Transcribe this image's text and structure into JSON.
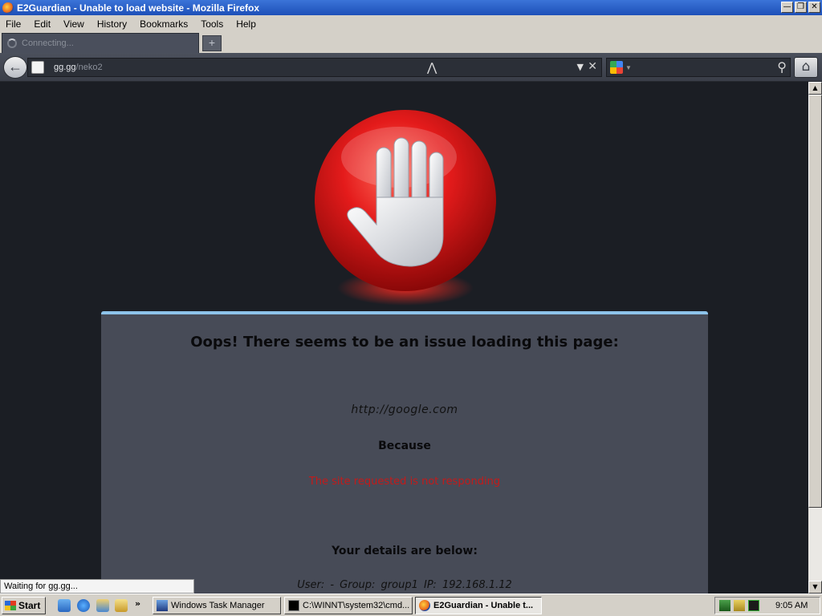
{
  "window": {
    "title": "E2Guardian - Unable to load website - Mozilla Firefox",
    "minimize": "0",
    "maximize": "2",
    "close": "r"
  },
  "menu": [
    "File",
    "Edit",
    "View",
    "History",
    "Bookmarks",
    "Tools",
    "Help"
  ],
  "tabs": [
    {
      "label": "Connecting...",
      "state": "loading"
    }
  ],
  "newtab_label": "+",
  "nav": {
    "url_host": "gg.gg",
    "url_path": "/neko2",
    "search_engine_icon": "google-icon",
    "search_placeholder": "",
    "back_icon": "back-arrow-icon",
    "home_icon": "home-icon"
  },
  "page": {
    "title": "Oops! There seems to be an issue loading this page:",
    "url": "http://google.com",
    "because": "Because",
    "reason": "The site requested is not responding",
    "details_title": "Your details are below:",
    "user_line": "User: -   Group: group1   IP: 192.168.1.12",
    "reason_color": "#c41a1a",
    "card_accent": "#8dc3ea"
  },
  "status": "Waiting for gg.gg...",
  "taskbar": {
    "start": "Start",
    "quicklaunch": [
      "show-desktop-icon",
      "ie-icon",
      "outlook-icon",
      "explorer-icon"
    ],
    "more": "»",
    "tasks": [
      {
        "label": "Windows Task Manager",
        "active": false
      },
      {
        "label": "C:\\WINNT\\system32\\cmd...",
        "active": false
      },
      {
        "label": "E2Guardian - Unable t...",
        "active": true
      }
    ],
    "clock": "9:05 AM"
  }
}
